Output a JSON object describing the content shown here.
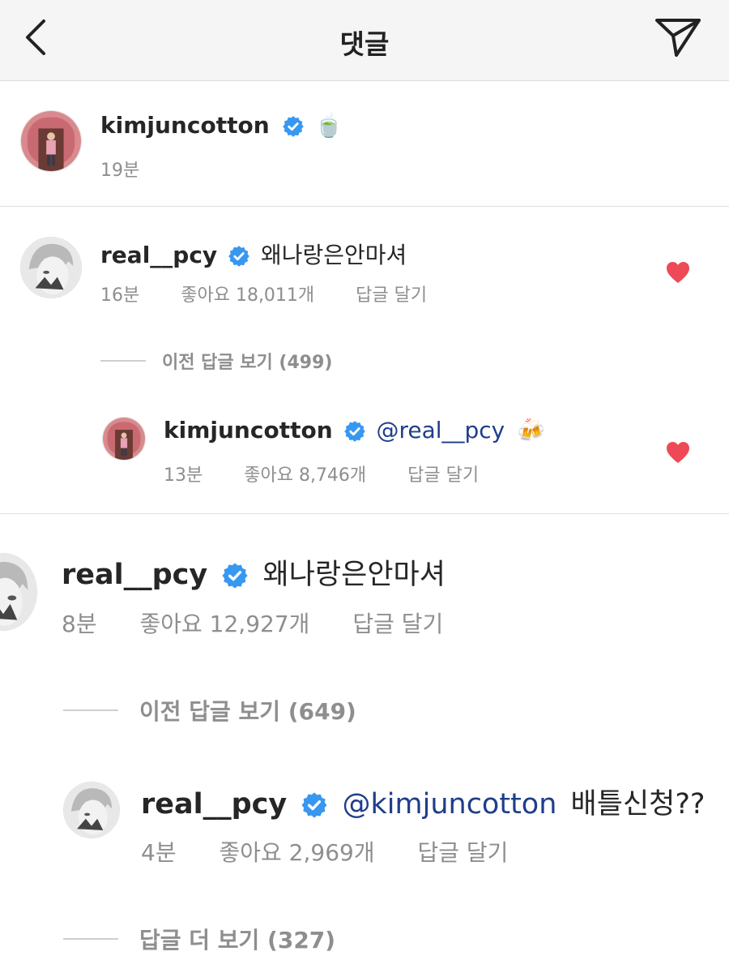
{
  "header": {
    "title": "댓글",
    "back_icon": "chevron-left-icon",
    "send_icon": "paper-plane-icon"
  },
  "caption": {
    "username": "kimjuncotton",
    "text": "🍵",
    "time": "19분"
  },
  "comments": [
    {
      "username": "real__pcy",
      "text": "왜나랑은안마셔",
      "time": "16분",
      "likes": "좋아요 18,011개",
      "reply_label": "답글 달기",
      "liked": true,
      "view_replies": "이전 답글 보기 (499)",
      "reply": {
        "username": "kimjuncotton",
        "mention": "@real__pcy",
        "text": "🍻",
        "time": "13분",
        "likes": "좋아요 8,746개",
        "reply_label": "답글 달기",
        "liked": true
      }
    },
    {
      "username": "real__pcy",
      "text": "왜나랑은안마셔",
      "time": "8분",
      "likes": "좋아요 12,927개",
      "reply_label": "답글 달기",
      "view_replies": "이전 답글 보기 (649)",
      "reply": {
        "username": "real__pcy",
        "mention": "@kimjuncotton",
        "text": "배틀신청??",
        "time": "4분",
        "likes": "좋아요 2,969개",
        "reply_label": "답글 달기"
      },
      "more_replies": "답글 더 보기 (327)"
    }
  ],
  "colors": {
    "heart": "#ed4956",
    "verified": "#3897f0",
    "mention": "#1f3e8a",
    "meta": "#8e8e8e"
  }
}
